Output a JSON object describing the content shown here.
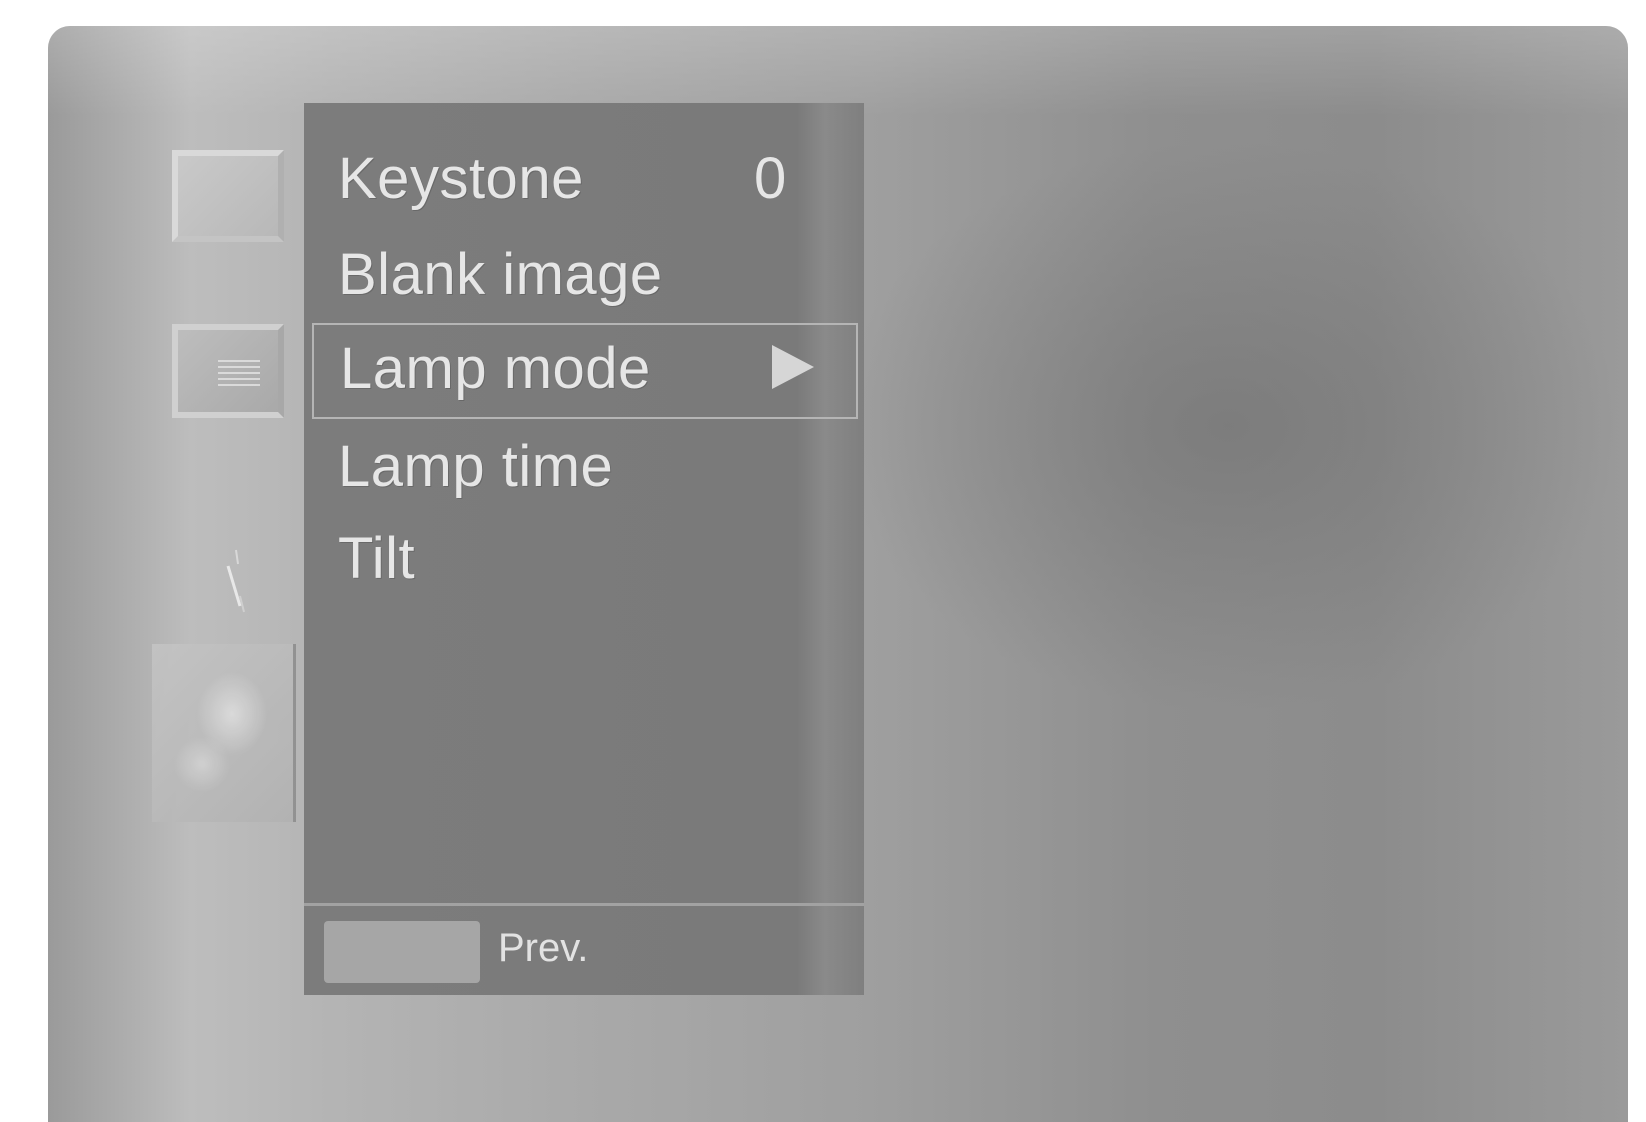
{
  "menu": {
    "items": [
      {
        "label": "Keystone",
        "value": "0"
      },
      {
        "label": "Blank image"
      },
      {
        "label": "Lamp mode",
        "selected": true,
        "indicator": "right-arrow-icon"
      },
      {
        "label": "Lamp time"
      },
      {
        "label": "Tilt"
      }
    ]
  },
  "footer": {
    "button_icon": "menu-button-icon",
    "label": "Prev."
  },
  "categories": [
    {
      "icon": "picture-category-icon"
    },
    {
      "icon": "screen-category-icon"
    },
    {
      "icon": "tool-category-icon"
    },
    {
      "icon": "special-category-icon"
    }
  ],
  "colors": {
    "menu_background": "#7c7c7c",
    "text": "#e6e6e6",
    "selection_border": "#b5b5b5"
  }
}
